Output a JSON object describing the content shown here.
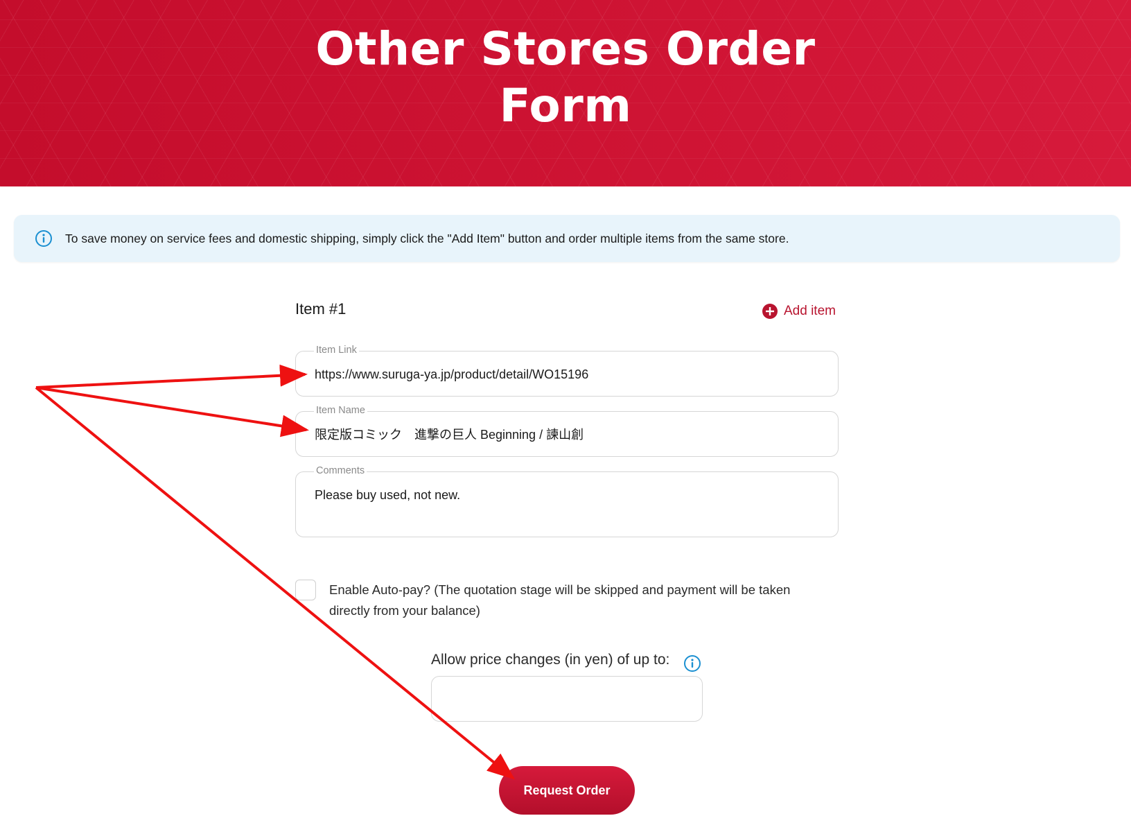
{
  "header": {
    "title_line1": "Other Stores Order",
    "title_line2": "Form"
  },
  "info_banner": {
    "icon": "info-circle-icon",
    "text": "To save money on service fees and domestic shipping, simply click the \"Add Item\" button and order multiple items from the same store."
  },
  "item": {
    "heading": "Item #1",
    "add_item_label": "Add item",
    "add_item_icon": "plus-circle-icon",
    "link": {
      "label": "Item Link",
      "value": "https://www.suruga-ya.jp/product/detail/WO15196"
    },
    "name": {
      "label": "Item Name",
      "value": "限定版コミック　進撃の巨人 Beginning / 諫山創"
    },
    "comments": {
      "label": "Comments",
      "value": "Please buy used, not new."
    }
  },
  "autopay": {
    "checked": false,
    "label": "Enable Auto-pay? (The quotation stage will be skipped and payment will be taken directly from your balance)"
  },
  "price_changes": {
    "label": "Allow price changes (in yen) of up to:",
    "icon": "info-circle-icon",
    "value": ""
  },
  "submit": {
    "label": "Request Order"
  },
  "colors": {
    "brand_red": "#c8102e",
    "info_blue": "#1a8fd1",
    "banner_bg": "#e8f4fb",
    "annotation_red": "#ee1111"
  }
}
